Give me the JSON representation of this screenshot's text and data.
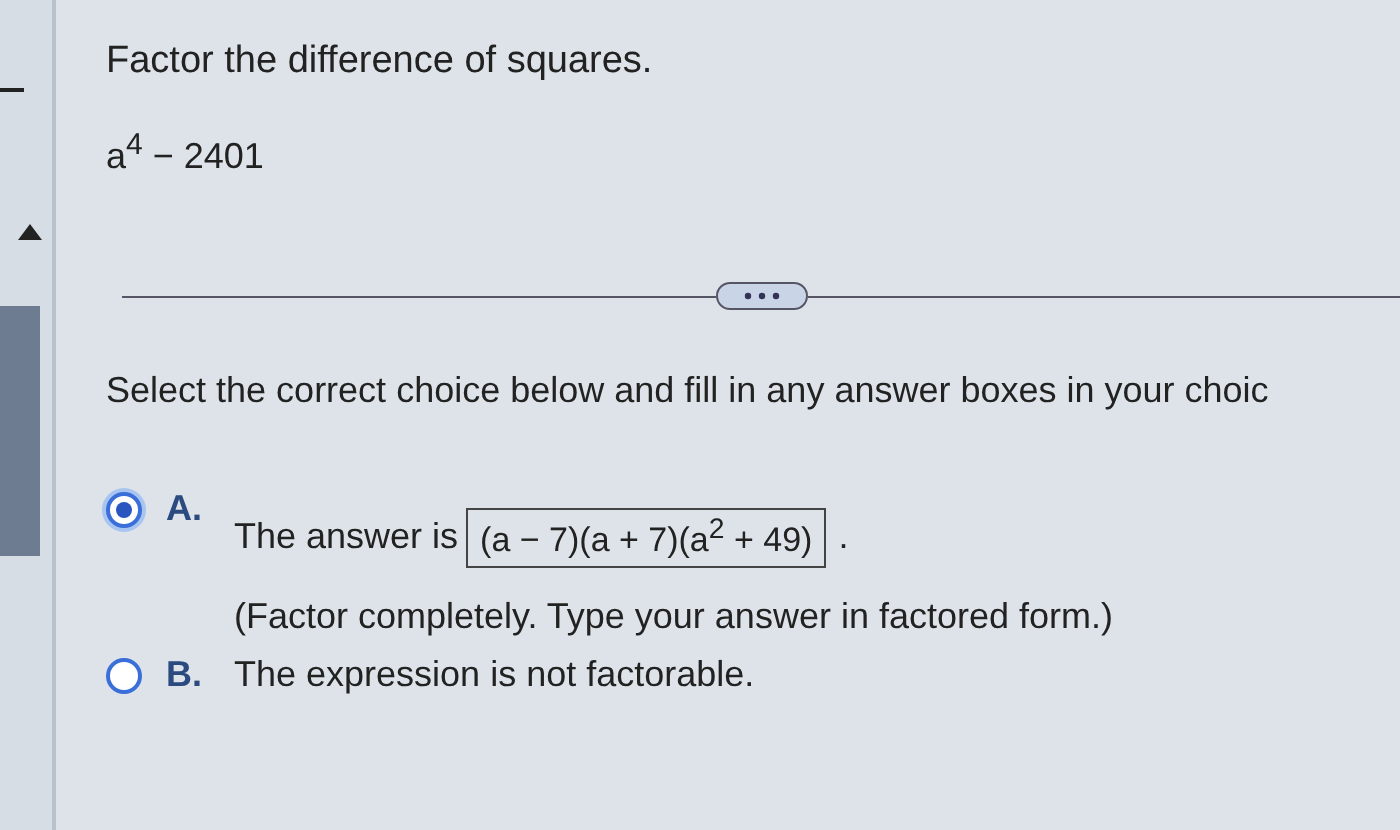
{
  "problem": {
    "instruction": "Factor the difference of squares.",
    "expression": "a$^{4}$ − 2401"
  },
  "prompt": "Select the correct choice below and fill in any answer boxes in your choic",
  "choices": [
    {
      "kind": "answer",
      "letter": "A.",
      "selected": true,
      "text": "The answer is",
      "answer": "(a − 7)(a + 7)(a$^{2}$ + 49)",
      "after": ".",
      "note": "(Factor completely. Type your answer in factored form.)"
    },
    {
      "kind": "plain",
      "letter": "B.",
      "selected": false,
      "text": "The expression is not factorable."
    }
  ]
}
